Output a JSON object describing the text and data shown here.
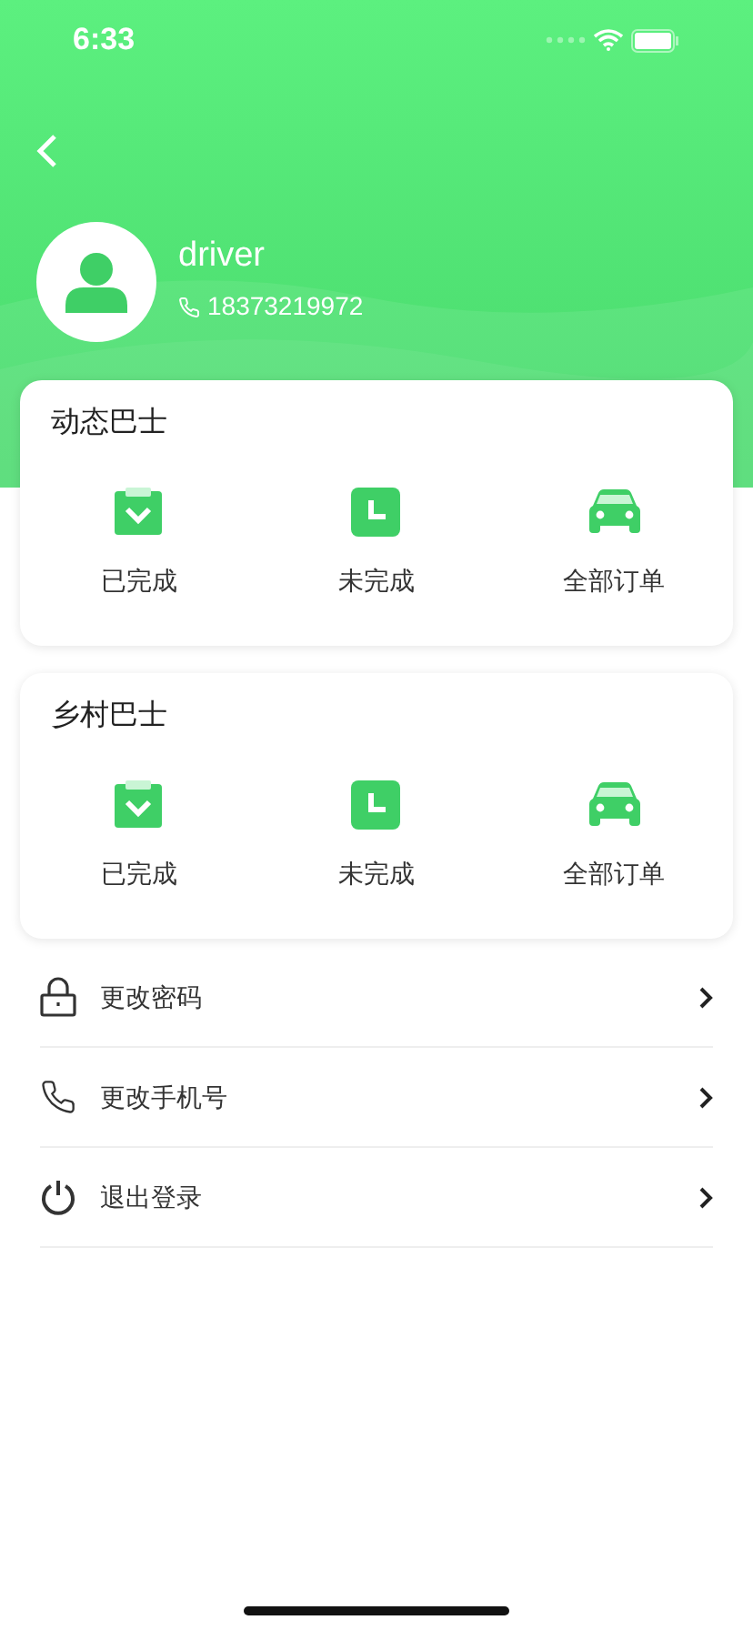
{
  "status_bar": {
    "time": "6:33"
  },
  "profile": {
    "name": "driver",
    "phone": "18373219972"
  },
  "sections": [
    {
      "title": "动态巴士",
      "items": [
        {
          "kind": "done",
          "label": "已完成"
        },
        {
          "kind": "pending",
          "label": "未完成"
        },
        {
          "kind": "all",
          "label": "全部订单"
        }
      ]
    },
    {
      "title": "乡村巴士",
      "items": [
        {
          "kind": "done",
          "label": "已完成"
        },
        {
          "kind": "pending",
          "label": "未完成"
        },
        {
          "kind": "all",
          "label": "全部订单"
        }
      ]
    }
  ],
  "menu": [
    {
      "kind": "lock",
      "label": "更改密码"
    },
    {
      "kind": "phone",
      "label": "更改手机号"
    },
    {
      "kind": "power",
      "label": "退出登录"
    }
  ]
}
